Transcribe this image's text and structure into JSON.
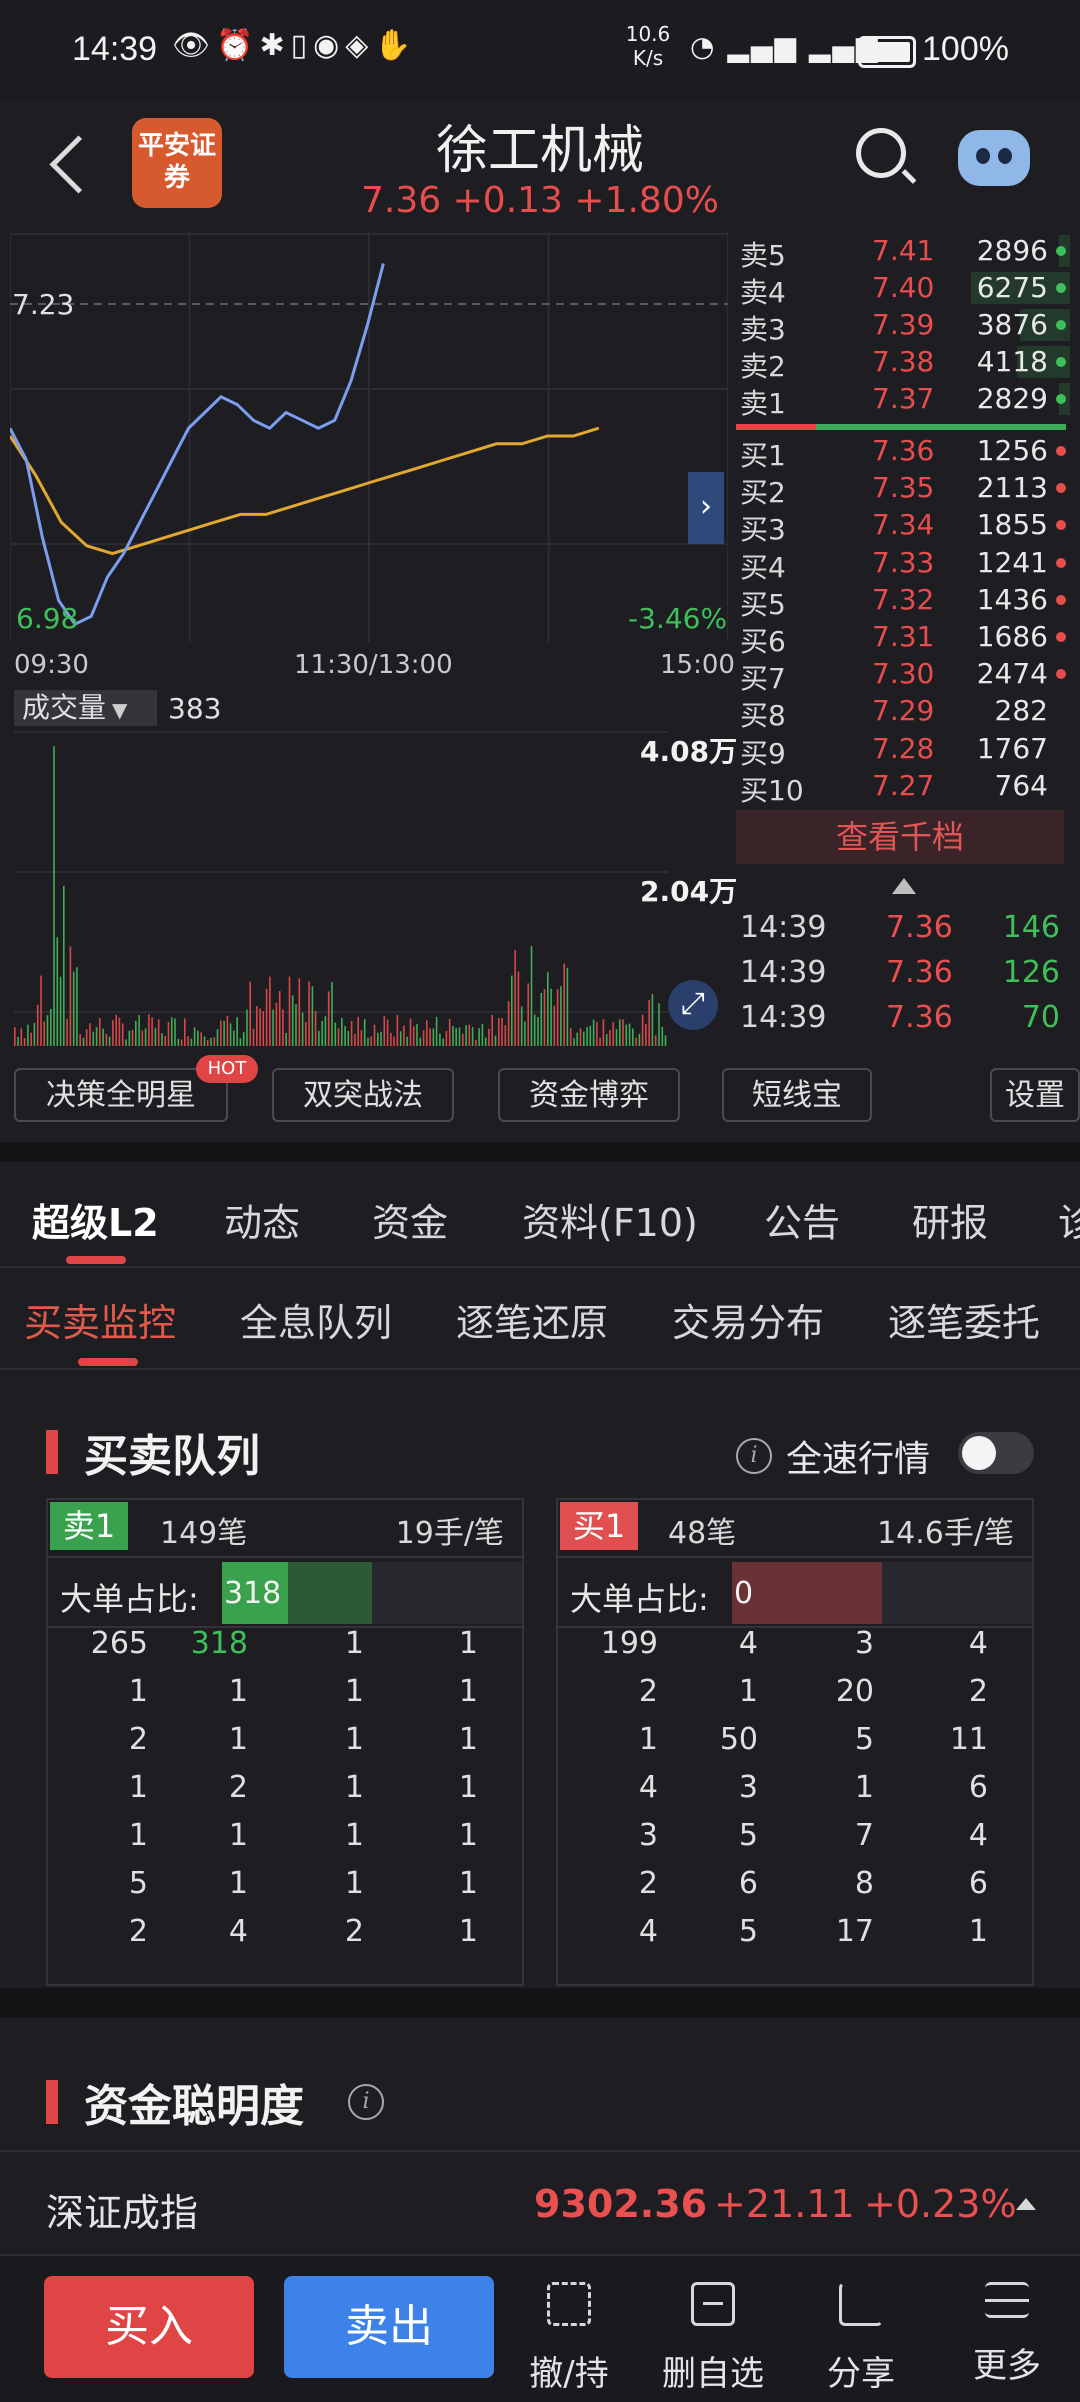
{
  "status_bar": {
    "time": "14:39",
    "net_speed_value": "10.6",
    "net_speed_unit": "K/s",
    "battery_pct": "100%"
  },
  "header": {
    "broker_logo_text": "平安证券",
    "stock_name": "徐工机械",
    "price": "7.36",
    "change": "+0.13",
    "change_pct": "+1.80%"
  },
  "chart": {
    "prev_close_label": "7.23",
    "low_label": "6.98",
    "low_pct_label": "-3.46%",
    "time_axis": [
      "09:30",
      "11:30/13:00",
      "15:00"
    ],
    "volume_selector": "成交量",
    "volume_value": "383",
    "volume_max_label": "4.08万",
    "volume_mid_label": "2.04万"
  },
  "chart_data": {
    "type": "line",
    "title": "",
    "xlabel": "",
    "ylabel": "",
    "x_ticks": [
      "09:30",
      "11:30/13:00",
      "15:00"
    ],
    "ylim": [
      6.98,
      7.48
    ],
    "prev_close": 7.23,
    "series": [
      {
        "values": [
          7.24,
          7.2,
          7.1,
          7.02,
          6.99,
          7.0,
          7.05,
          7.08,
          7.12,
          7.16,
          7.2,
          7.24,
          7.26,
          7.28,
          7.27,
          7.25,
          7.24,
          7.26,
          7.25,
          7.24,
          7.25,
          7.3,
          7.37,
          7.45
        ]
      },
      {
        "values": [
          7.23,
          7.18,
          7.12,
          7.09,
          7.08,
          7.09,
          7.1,
          7.11,
          7.12,
          7.13,
          7.13,
          7.14,
          7.15,
          7.16,
          7.17,
          7.18,
          7.19,
          7.2,
          7.21,
          7.22,
          7.22,
          7.23,
          7.23,
          7.24
        ]
      }
    ],
    "volume_ylim": [
      0,
      40800
    ]
  },
  "order_book": {
    "asks": [
      {
        "label": "卖5",
        "price": "7.41",
        "vol": "2896",
        "bar": 0.1
      },
      {
        "label": "卖4",
        "price": "7.40",
        "vol": "6275",
        "bar": 0.9
      },
      {
        "label": "卖3",
        "price": "7.39",
        "vol": "3876",
        "bar": 0.45
      },
      {
        "label": "卖2",
        "price": "7.38",
        "vol": "4118",
        "bar": 0.48
      },
      {
        "label": "卖1",
        "price": "7.37",
        "vol": "2829",
        "bar": 0.1
      }
    ],
    "bids": [
      {
        "label": "买1",
        "price": "7.36",
        "vol": "1256"
      },
      {
        "label": "买2",
        "price": "7.35",
        "vol": "2113"
      },
      {
        "label": "买3",
        "price": "7.34",
        "vol": "1855"
      },
      {
        "label": "买4",
        "price": "7.33",
        "vol": "1241"
      },
      {
        "label": "买5",
        "price": "7.32",
        "vol": "1436"
      },
      {
        "label": "买6",
        "price": "7.31",
        "vol": "1686"
      },
      {
        "label": "买7",
        "price": "7.30",
        "vol": "2474"
      },
      {
        "label": "买8",
        "price": "7.29",
        "vol": "282"
      },
      {
        "label": "买9",
        "price": "7.28",
        "vol": "1767"
      },
      {
        "label": "买10",
        "price": "7.27",
        "vol": "764"
      }
    ],
    "depth_button": "查看千档",
    "trades": [
      {
        "time": "14:39",
        "price": "7.36",
        "vol": "146"
      },
      {
        "time": "14:39",
        "price": "7.36",
        "vol": "126"
      },
      {
        "time": "14:39",
        "price": "7.36",
        "vol": "70"
      }
    ]
  },
  "tools": {
    "items": [
      "决策全明星",
      "双突战法",
      "资金博弈",
      "短线宝",
      "设置"
    ],
    "hot_badge": "HOT"
  },
  "main_tabs": [
    "超级L2",
    "动态",
    "资金",
    "资料(F10)",
    "公告",
    "研报",
    "诊"
  ],
  "sub_tabs": [
    "买卖监控",
    "全息队列",
    "逐笔还原",
    "交易分布",
    "逐笔委托"
  ],
  "queue": {
    "title": "买卖队列",
    "fast_quote_label": "全速行情",
    "sell": {
      "badge": "卖1",
      "orders": "149笔",
      "per_order": "19手/笔",
      "ratio_label": "大单占比:",
      "ratio_value": "318",
      "rows": [
        [
          "265",
          "318",
          "1",
          "1"
        ],
        [
          "1",
          "1",
          "1",
          "1"
        ],
        [
          "2",
          "1",
          "1",
          "1"
        ],
        [
          "1",
          "2",
          "1",
          "1"
        ],
        [
          "1",
          "1",
          "1",
          "1"
        ],
        [
          "5",
          "1",
          "1",
          "1"
        ],
        [
          "2",
          "4",
          "2",
          "1"
        ]
      ]
    },
    "buy": {
      "badge": "买1",
      "orders": "48笔",
      "per_order": "14.6手/笔",
      "ratio_label": "大单占比:",
      "ratio_value": "0",
      "rows": [
        [
          "199",
          "4",
          "3",
          "4"
        ],
        [
          "2",
          "1",
          "20",
          "2"
        ],
        [
          "1",
          "50",
          "5",
          "11"
        ],
        [
          "4",
          "3",
          "1",
          "6"
        ],
        [
          "3",
          "5",
          "7",
          "4"
        ],
        [
          "2",
          "6",
          "8",
          "6"
        ],
        [
          "4",
          "5",
          "17",
          "1"
        ]
      ]
    }
  },
  "fund_section": {
    "title": "资金聪明度",
    "index_name": "深证成指",
    "index_value": "9302.36",
    "index_change": "+21.11",
    "index_change_pct": "+0.23%"
  },
  "bottom_bar": {
    "buy": "买入",
    "sell": "卖出",
    "items": [
      "撤/持",
      "删自选",
      "分享",
      "更多"
    ]
  },
  "colors": {
    "up": "#e84d4d",
    "down": "#3fbf5a",
    "price_line": "#7c9ef0",
    "avg_line": "#e0a830",
    "accent_blue": "#3d82e8"
  }
}
